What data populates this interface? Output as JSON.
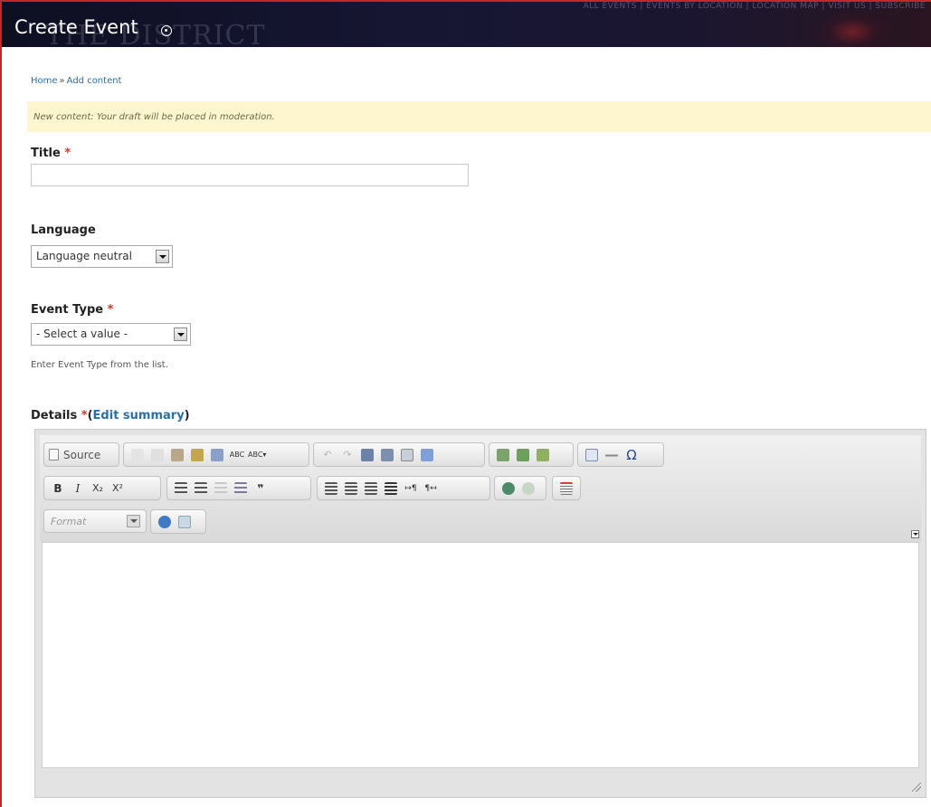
{
  "header": {
    "title": "Create Event",
    "background_text": "THE DISTRICT",
    "top_links": "ALL EVENTS | EVENTS BY LOCATION | LOCATION MAP | VISIT US | SUBSCRIBE"
  },
  "breadcrumb": {
    "home": "Home",
    "separator": "»",
    "current": "Add content"
  },
  "message": "New content: Your draft will be placed in moderation.",
  "form": {
    "title_label": "Title",
    "required_mark": "*",
    "title_value": "",
    "language_label": "Language",
    "language_selected": "Language neutral",
    "event_type_label": "Event Type",
    "event_type_selected": "- Select a value -",
    "event_type_help": "Enter Event Type from the list.",
    "details_label": "Details",
    "edit_summary_open": "(",
    "edit_summary_link": "Edit summary",
    "edit_summary_close": ")"
  },
  "editor": {
    "source_label": "Source",
    "format_placeholder": "Format",
    "bold_label": "B",
    "italic_label": "I",
    "subscript_label": "X₂",
    "superscript_label": "X²",
    "spell_label": "ABC",
    "spell_label2": "ABC▾",
    "blockquote_label": "❞",
    "special_char_label": "Ω",
    "body_text": ""
  }
}
